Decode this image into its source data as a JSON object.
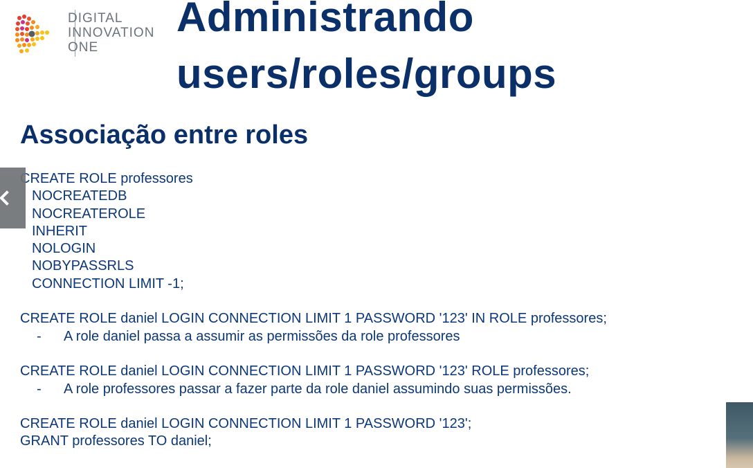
{
  "logo": {
    "line1": "DIGITAL",
    "line2": "INNOVATION",
    "line3": "ONE",
    "colors": [
      "#e63d2e",
      "#f28c1b",
      "#f7c21a",
      "#c7338a",
      "#6c737b"
    ]
  },
  "slide": {
    "title_line1": "Administrando",
    "title_line2": "users/roles/groups",
    "section_title": "Associação entre roles",
    "code": {
      "l1": "CREATE ROLE professores",
      "l2": "NOCREATEDB",
      "l3": "NOCREATEROLE",
      "l4": "INHERIT",
      "l5": "NOLOGIN",
      "l6": "NOBYPASSRLS",
      "l7": "CONNECTION LIMIT -1;",
      "l8": "CREATE ROLE daniel LOGIN CONNECTION LIMIT 1 PASSWORD '123' IN ROLE professores;",
      "b1": "A role daniel passa a assumir as permissões da role professores",
      "l9": "CREATE ROLE daniel LOGIN CONNECTION LIMIT 1 PASSWORD '123' ROLE professores;",
      "b2": "A role professores passar a fazer parte da role daniel assumindo suas permissões.",
      "l10": "CREATE ROLE daniel LOGIN CONNECTION LIMIT 1 PASSWORD '123';",
      "l11": "GRANT professores TO daniel;",
      "dash": "-"
    }
  },
  "controls": {
    "prev_icon": "chevron-left-icon"
  },
  "colors": {
    "title": "#0b2f68",
    "body_text": "#0c3779",
    "prev_button_bg": "#6f7276"
  }
}
